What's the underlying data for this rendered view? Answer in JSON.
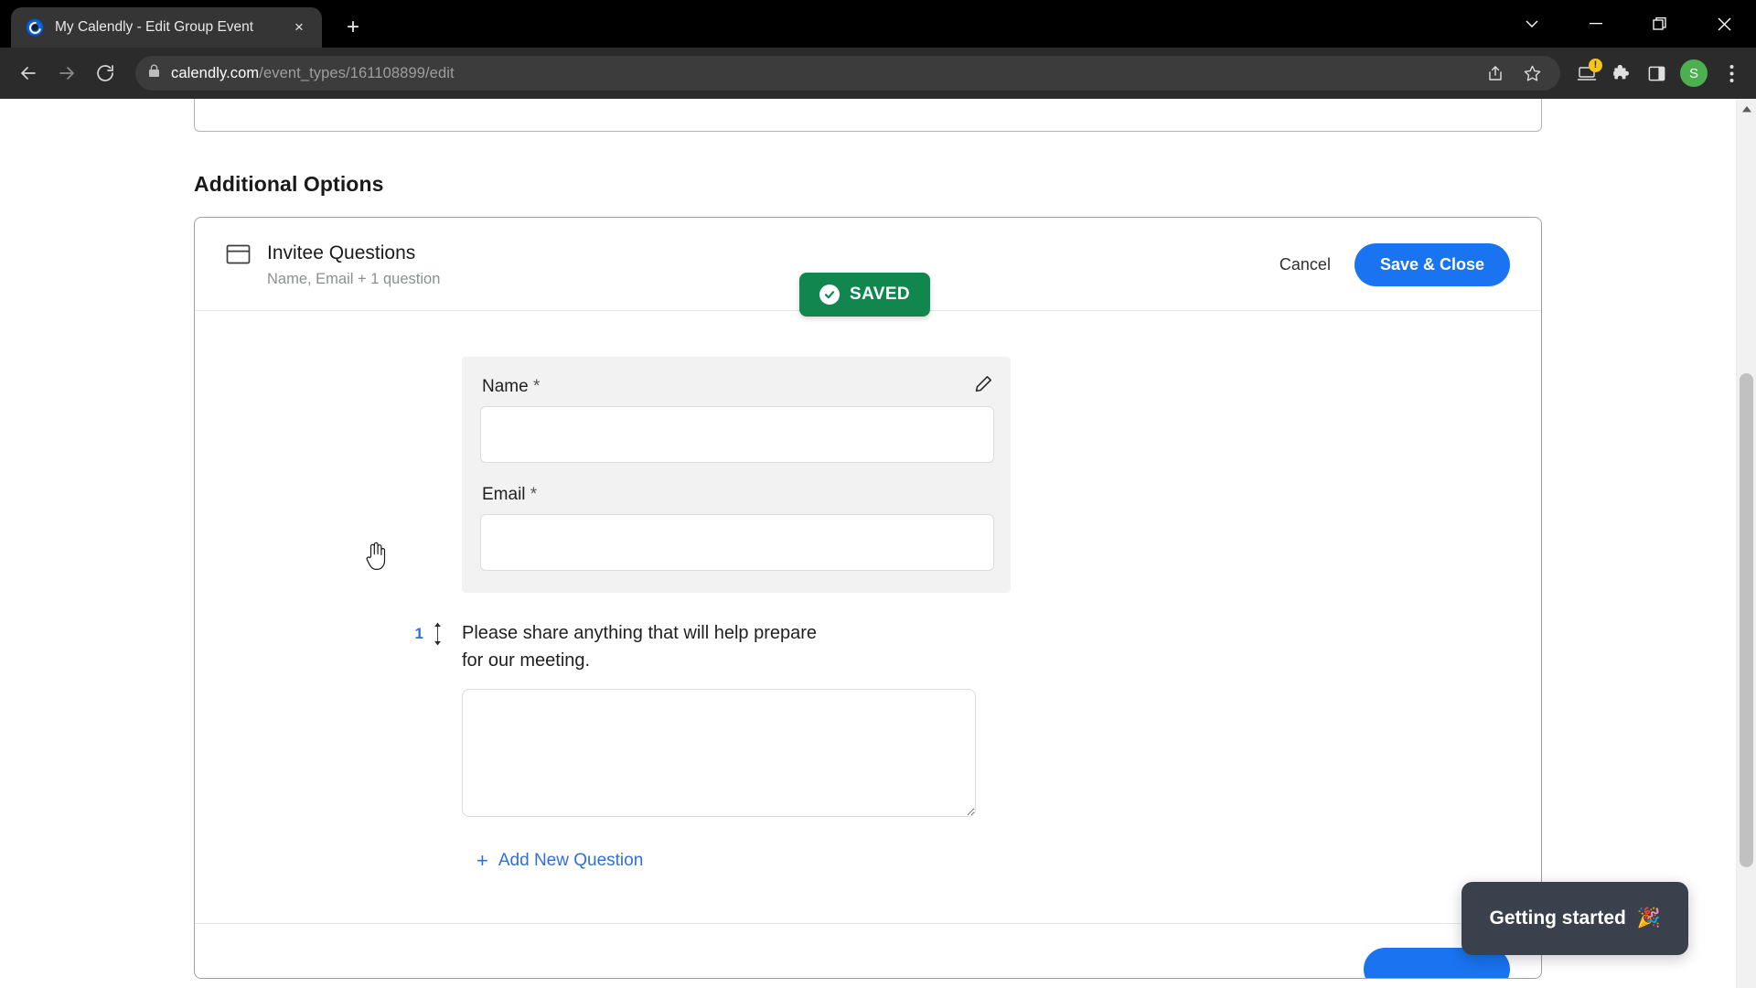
{
  "browser": {
    "tab": {
      "title": "My Calendly - Edit Group Event",
      "favicon": "calendly-logo-icon",
      "close_label": "×"
    },
    "newtab_label": "+",
    "window_controls": {
      "tab_search": "chevron-down-icon",
      "minimize": "minimize-icon",
      "maximize": "maximize-icon",
      "close": "close-icon"
    },
    "nav": {
      "back": "back-arrow-icon",
      "forward": "forward-arrow-icon",
      "reload": "reload-icon"
    },
    "omnibox": {
      "lock": "lock-icon",
      "url_domain": "calendly.com",
      "url_path": "/event_types/161108899/edit",
      "share_icon": "share-icon",
      "bookmark_icon": "star-icon"
    },
    "actions": {
      "update_icon": "laptop-update-icon",
      "update_badge": "!",
      "extensions_icon": "puzzle-piece-icon",
      "sidepanel_icon": "side-panel-icon",
      "profile_initial": "S",
      "menu_icon": "three-dot-menu-icon"
    }
  },
  "page": {
    "section_heading": "Additional Options",
    "saved_badge": {
      "label": "SAVED",
      "color": "#11864f"
    },
    "panel": {
      "icon": "form-window-icon",
      "title": "Invitee Questions",
      "subtitle": "Name, Email + 1 question",
      "cancel_label": "Cancel",
      "save_label": "Save & Close"
    },
    "form": {
      "fields": [
        {
          "label": "Name",
          "required_marker": "*",
          "value": "",
          "placeholder": ""
        },
        {
          "label": "Email",
          "required_marker": "*",
          "value": "",
          "placeholder": ""
        }
      ],
      "edit_icon": "pencil-icon",
      "questions": [
        {
          "number": "1",
          "sort_icon": "sort-updown-icon",
          "text": "Please share anything that will help prepare for our meeting.",
          "value": "",
          "placeholder": ""
        }
      ],
      "add_question": {
        "plus": "+",
        "label": "Add New Question"
      }
    }
  },
  "widget": {
    "label": "Getting started",
    "emoji": "🎉",
    "background": "#3a414d"
  },
  "scrollbar": {
    "up_arrow": "scroll-up-arrow-icon"
  }
}
